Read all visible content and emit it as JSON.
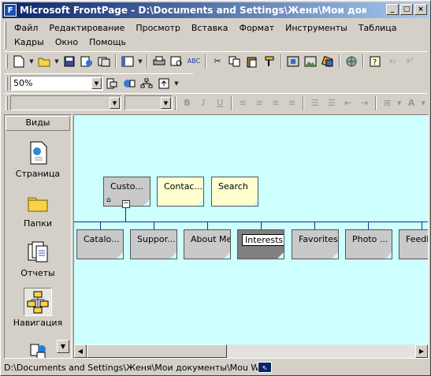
{
  "window": {
    "title": "Microsoft FrontPage - D:\\Documents and Settings\\Женя\\Мои документы\\Моu",
    "min_label": "_",
    "max_label": "□",
    "close_label": "×"
  },
  "menu": [
    "Файл",
    "Редактирование",
    "Просмотр",
    "Вставка",
    "Формат",
    "Инструменты",
    "Таблица",
    "Кадры",
    "Окно",
    "Помощь"
  ],
  "toolbar2": {
    "zoom_value": "50%"
  },
  "views": {
    "title": "Виды",
    "items": [
      {
        "label": "Страница",
        "icon": "page-view-icon"
      },
      {
        "label": "Папки",
        "icon": "folders-view-icon"
      },
      {
        "label": "Отчеты",
        "icon": "reports-view-icon"
      },
      {
        "label": "Навигация",
        "icon": "navigation-view-icon",
        "active": true
      }
    ]
  },
  "navigation": {
    "top_pages": [
      {
        "label": "Custo...",
        "style": "grey",
        "home": true
      },
      {
        "label": "Contac...",
        "style": "yellow"
      },
      {
        "label": "Search",
        "style": "yellow"
      }
    ],
    "child_pages": [
      {
        "label": "Catalo..."
      },
      {
        "label": "Suppor..."
      },
      {
        "label": "About Me"
      },
      {
        "label": "Interests",
        "selected": true
      },
      {
        "label": "Favorites"
      },
      {
        "label": "Photo ..."
      },
      {
        "label": "Feedb"
      }
    ]
  },
  "status": {
    "text": "D:\\Documents and Settings\\Женя\\Мои документы\\Моu Web\\myw"
  }
}
